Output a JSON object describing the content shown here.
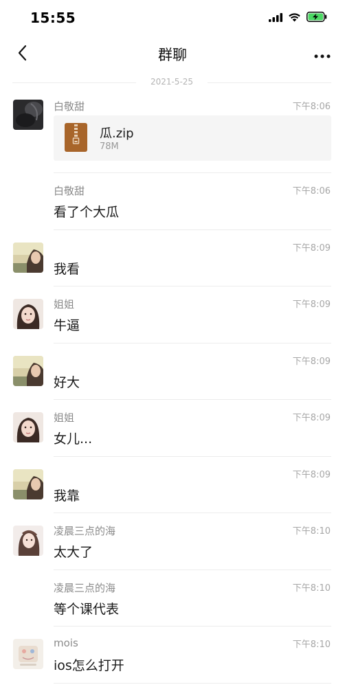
{
  "status": {
    "time": "15:55"
  },
  "nav": {
    "title": "群聊"
  },
  "date_divider": "2021-5-25",
  "file_message": {
    "sender": "白敬甜",
    "time": "下午8:06",
    "file_name": "瓜.zip",
    "file_size": "78M"
  },
  "messages": [
    {
      "sender": "白敬甜",
      "time": "下午8:06",
      "text": "看了个大瓜"
    },
    {
      "sender": "",
      "time": "下午8:09",
      "text": "我看"
    },
    {
      "sender": "姐姐",
      "time": "下午8:09",
      "text": "牛逼"
    },
    {
      "sender": "",
      "time": "下午8:09",
      "text": "好大"
    },
    {
      "sender": "姐姐",
      "time": "下午8:09",
      "text": "女儿..."
    },
    {
      "sender": "",
      "time": "下午8:09",
      "text": "我靠"
    },
    {
      "sender": "凌晨三点的海",
      "time": "下午8:10",
      "text": "太大了"
    },
    {
      "sender": "凌晨三点的海",
      "time": "下午8:10",
      "text": "等个课代表"
    },
    {
      "sender": "mois",
      "time": "下午8:10",
      "text": "ios怎么打开"
    }
  ],
  "colors": {
    "battery": "#4cd964",
    "file_icon": "#a8652a"
  },
  "icons": [
    "back-chevron-icon",
    "more-dots-icon",
    "signal-icon",
    "wifi-icon",
    "battery-charging-icon",
    "zip-file-icon"
  ]
}
